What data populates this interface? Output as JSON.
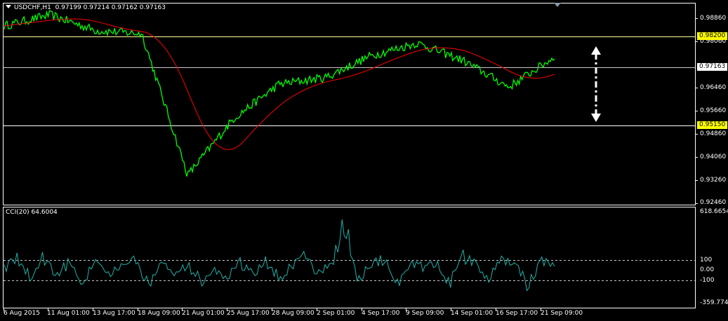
{
  "main_chart": {
    "symbol_timeframe": "USDCHF,H1",
    "ohlc": "0.97199 0.97214 0.97162 0.97163",
    "price_scale": [
      "0.98860",
      "0.98060",
      "0.96460",
      "0.95660",
      "0.94860",
      "0.94060",
      "0.93260",
      "0.92460"
    ],
    "levels": {
      "upper": "0.98200",
      "current": "0.97163",
      "lower": "0.95150"
    }
  },
  "cci_panel": {
    "title": "CCI(20) 64.6004",
    "scale": [
      "618.6654",
      "100",
      "0.00",
      "-100",
      "-359.7749"
    ]
  },
  "time_axis": [
    "6 Aug 2015",
    "11 Aug 01:00",
    "13 Aug 17:00",
    "18 Aug 09:00",
    "21 Aug 01:00",
    "25 Aug 17:00",
    "28 Aug 09:00",
    "2 Sep 01:00",
    "4 Sep 17:00",
    "9 Sep 09:00",
    "14 Sep 01:00",
    "16 Sep 17:00",
    "21 Sep 09:00"
  ],
  "colors": {
    "price": "#00ff00",
    "moving_average": "#ff0000",
    "cci": "#20b2aa",
    "level_line": "#ffff99",
    "level_label_bg": "#ffff00",
    "frame": "#ffffff"
  },
  "chart_data": [
    {
      "type": "line",
      "series": [
        {
          "name": "",
          "x": [
            "6 Aug 2015",
            "11 Aug 01:00",
            "13 Aug 17:00",
            "18 Aug 09:00",
            "21 Aug 01:00",
            "25 Aug 17:00",
            "28 Aug 09:00",
            "2 Sep 01:00",
            "4 Sep 17:00",
            "9 Sep 09:00",
            "14 Sep 01:00",
            "16 Sep 17:00",
            "21 Sep 09:00"
          ],
          "values": [
            0.9815,
            0.985,
            0.98,
            0.979,
            0.934,
            0.952,
            0.963,
            0.965,
            0.972,
            0.976,
            0.9705,
            0.962,
            0.9716
          ]
        }
      ],
      "ylim": [
        0.9246,
        0.9886
      ],
      "horizontal_levels": [
        0.982,
        0.97163,
        0.9515
      ]
    },
    {
      "type": "line",
      "series": [
        {
          "name": "CCI(20)",
          "values": [
            60,
            180,
            -120,
            210,
            -80,
            150,
            -190,
            120,
            -60,
            30,
            160,
            -210,
            90,
            -30,
            110,
            -170,
            40,
            -90,
            130,
            -20,
            150,
            -120,
            60,
            210,
            -80,
            100,
            618,
            -150,
            80,
            180,
            -200,
            110,
            40,
            120,
            -190,
            210,
            90,
            -120,
            160,
            70,
            -230,
            150,
            64.6
          ]
        }
      ],
      "ylim": [
        -359.7749,
        618.6654
      ],
      "horizontal_levels": [
        100,
        -100
      ]
    }
  ]
}
